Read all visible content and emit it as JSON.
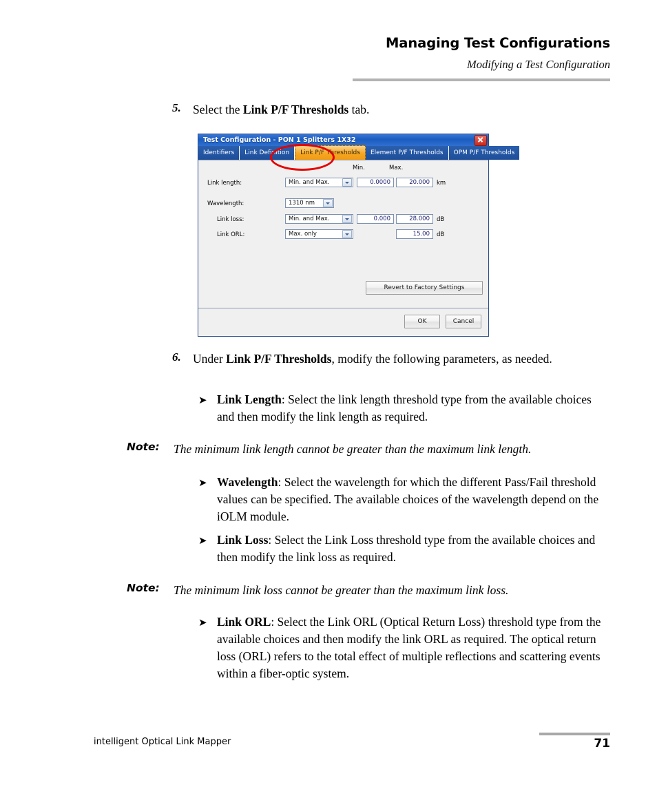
{
  "header": {
    "title": "Managing Test Configurations",
    "subtitle": "Modifying a Test Configuration"
  },
  "footer": {
    "product": "intelligent Optical Link Mapper",
    "page_number": "71"
  },
  "steps": {
    "step5": {
      "number": "5.",
      "text_before": "Select the ",
      "text_bold": "Link P/F Thresholds",
      "text_after": " tab."
    },
    "step6": {
      "number": "6.",
      "text_before": "Under ",
      "text_bold": "Link P/F Thresholds",
      "text_after": ", modify the following parameters, as needed."
    }
  },
  "bullets": [
    {
      "marker": "➤",
      "term": "Link Length",
      "body": ": Select the link length threshold type from the available choices and then modify the link length as required."
    },
    {
      "marker": "➤",
      "term": "Wavelength",
      "body": ": Select the wavelength for which the different Pass/Fail threshold values can be specified. The available choices of the wavelength depend on the iOLM module."
    },
    {
      "marker": "➤",
      "term": "Link Loss",
      "body": ": Select the Link Loss threshold type from the available choices and then modify the link loss as required."
    },
    {
      "marker": "➤",
      "term": "Link ORL",
      "body": ": Select the Link ORL (Optical Return Loss) threshold type from the available choices and then modify the link ORL as required. The optical return loss (ORL) refers to the total effect of multiple reflections and scattering events within a fiber-optic system."
    }
  ],
  "notes": [
    {
      "label": "Note:",
      "text": "The minimum link length cannot be greater than the maximum link length."
    },
    {
      "label": "Note:",
      "text": "The minimum link loss cannot be greater than the maximum link loss."
    }
  ],
  "dialog": {
    "title": "Test Configuration - PON 1 Splitters 1X32",
    "close_icon": "close-icon",
    "tabs": [
      {
        "label": "Identifiers",
        "selected": false
      },
      {
        "label": "Link Definition",
        "selected": false
      },
      {
        "label": "Link P/F Thresholds",
        "selected": true
      },
      {
        "label": "Element P/F Thresholds",
        "selected": false
      },
      {
        "label": "OPM P/F Thresholds",
        "selected": false
      }
    ],
    "column_headers": {
      "min": "Min.",
      "max": "Max."
    },
    "fields": {
      "link_length": {
        "label": "Link length:",
        "mode": "Min. and Max.",
        "min": "0.0000",
        "max": "20.000",
        "unit": "km"
      },
      "wavelength": {
        "label": "Wavelength:",
        "value": "1310 nm"
      },
      "link_loss": {
        "label": "Link loss:",
        "mode": "Min. and Max.",
        "min": "0.000",
        "max": "28.000",
        "unit": "dB"
      },
      "link_orl": {
        "label": "Link ORL:",
        "mode": "Max. only",
        "max": "15.00",
        "unit": "dB"
      }
    },
    "buttons": {
      "revert": "Revert to Factory Settings",
      "ok": "OK",
      "cancel": "Cancel"
    }
  },
  "colors": {
    "titlebar_blue": "#1b5cc0",
    "tab_blue": "#1e4e99",
    "tab_selected_orange": "#f6a623",
    "annotation_red": "#e60000",
    "close_red": "#c8281b"
  }
}
